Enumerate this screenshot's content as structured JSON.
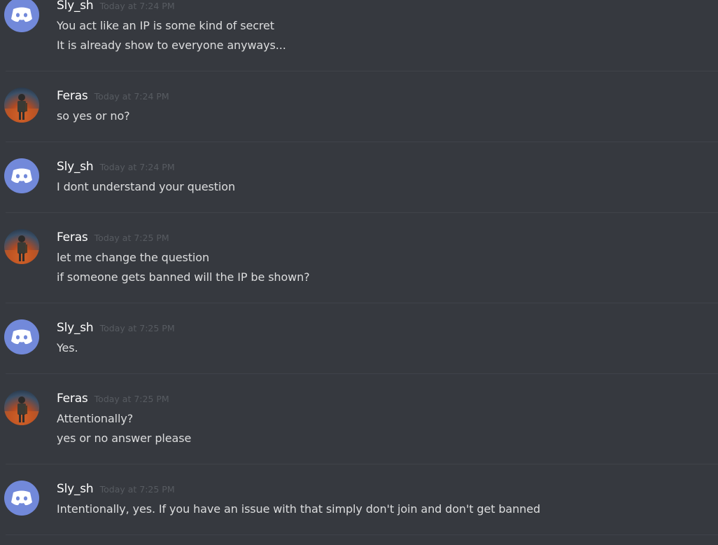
{
  "messages": [
    {
      "author": "Sly_sh",
      "timestamp": "Today at 7:24 PM",
      "avatar": "discord-default-icon",
      "lines": [
        "You act like an IP is some kind of secret",
        "It is already show to everyone anyways..."
      ]
    },
    {
      "author": "Feras",
      "timestamp": "Today at 7:24 PM",
      "avatar": "pubg-character-avatar",
      "lines": [
        "so yes or no?"
      ]
    },
    {
      "author": "Sly_sh",
      "timestamp": "Today at 7:24 PM",
      "avatar": "discord-default-icon",
      "lines": [
        "I dont understand your question"
      ]
    },
    {
      "author": "Feras",
      "timestamp": "Today at 7:25 PM",
      "avatar": "pubg-character-avatar",
      "lines": [
        "let me change the question",
        "if someone gets banned will the IP be shown?"
      ]
    },
    {
      "author": "Sly_sh",
      "timestamp": "Today at 7:25 PM",
      "avatar": "discord-default-icon",
      "lines": [
        "Yes."
      ]
    },
    {
      "author": "Feras",
      "timestamp": "Today at 7:25 PM",
      "avatar": "pubg-character-avatar",
      "lines": [
        "Attentionally?",
        "yes or no answer please"
      ]
    },
    {
      "author": "Sly_sh",
      "timestamp": "Today at 7:25 PM",
      "avatar": "discord-default-icon",
      "lines": [
        "Intentionally, yes. If you have an issue with that simply don't join and don't get banned"
      ]
    }
  ],
  "colors": {
    "background": "#36393f",
    "divider": "#40434a",
    "username": "#ffffff",
    "message_text": "#dcddde",
    "timestamp": "#575b61",
    "blurple": "#7289da"
  }
}
